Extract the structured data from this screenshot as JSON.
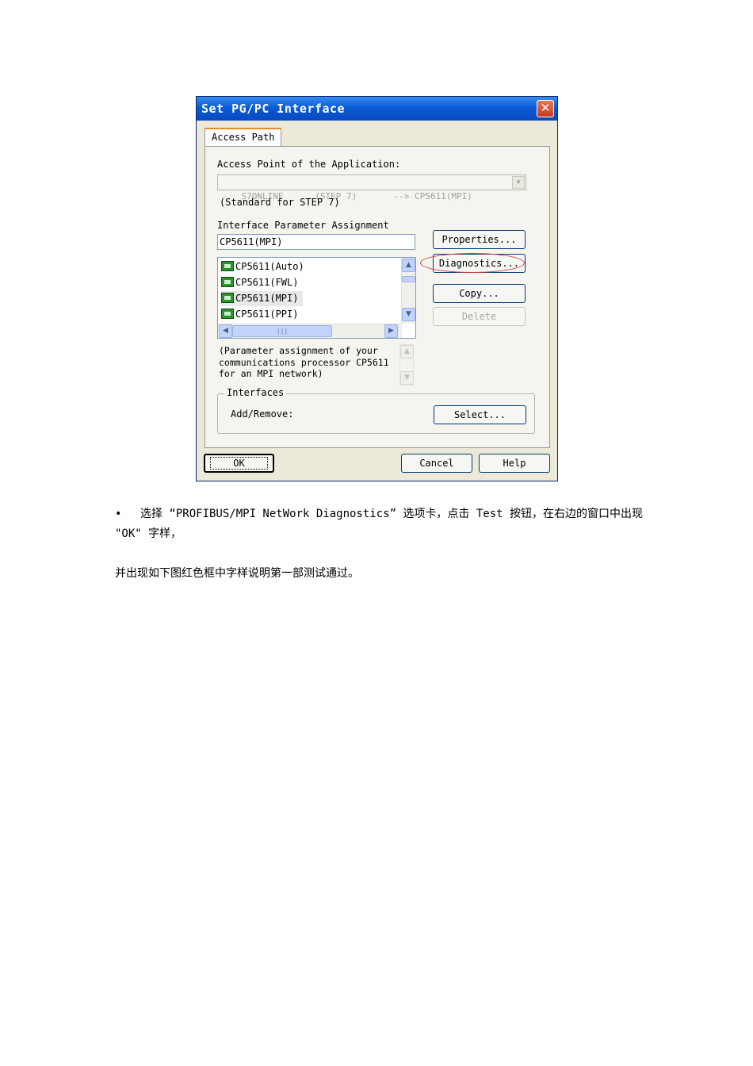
{
  "dialog": {
    "title": "Set PG/PC Interface",
    "close_glyph": "✕",
    "tab_label": "Access Path",
    "access_point_label": "Access Point of the Application:",
    "access_point_value": "S7ONLINE      (STEP 7)       --> CP5611(MPI)",
    "access_point_note": "(Standard for STEP 7)",
    "interface_param_label": "Interface Parameter Assignment",
    "interface_param_value": "CP5611(MPI)",
    "list_items": [
      "CP5611(Auto)",
      "CP5611(FWL)",
      "CP5611(MPI)",
      "CP5611(PPI)"
    ],
    "selected_item": "CP5611(MPI)",
    "description": "(Parameter assignment of your communications processor CP5611 for an MPI network)",
    "buttons": {
      "properties": "Properties...",
      "diagnostics": "Diagnostics...",
      "copy": "Copy...",
      "delete": "Delete"
    },
    "interfaces_group": {
      "title": "Interfaces",
      "add_remove_label": "Add/Remove:",
      "select_button": "Select..."
    },
    "footer": {
      "ok": "OK",
      "cancel": "Cancel",
      "help": "Help"
    },
    "highlight_color": "#d0403a"
  },
  "document": {
    "bullet": "•",
    "paragraph1": "选择 “PROFIBUS/MPI NetWork Diagnostics” 选项卡，点击 Test 按钮，在右边的窗口中出现 \"OK\" 字样，",
    "paragraph2": "并出现如下图红色框中字样说明第一部测试通过。"
  }
}
